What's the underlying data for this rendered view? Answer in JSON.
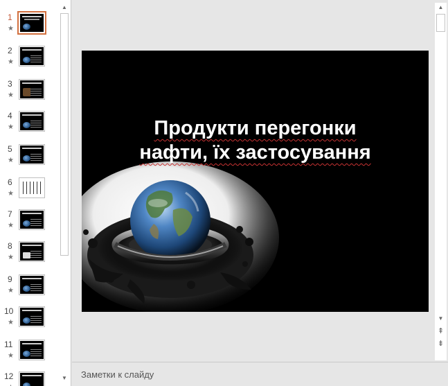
{
  "thumbnails": [
    {
      "number": "1",
      "star": "★",
      "selected": true
    },
    {
      "number": "2",
      "star": "★"
    },
    {
      "number": "3",
      "star": "★"
    },
    {
      "number": "4",
      "star": "★"
    },
    {
      "number": "5",
      "star": "★"
    },
    {
      "number": "6",
      "star": "★"
    },
    {
      "number": "7",
      "star": "★"
    },
    {
      "number": "8",
      "star": "★"
    },
    {
      "number": "9",
      "star": "★"
    },
    {
      "number": "10",
      "star": "★"
    },
    {
      "number": "11",
      "star": "★"
    },
    {
      "number": "12",
      "star": "★"
    }
  ],
  "slide": {
    "title_line1": "Продукти перегонки",
    "title_line2": "нафти, їх застосування"
  },
  "notes": {
    "placeholder": "Заметки к слайду"
  },
  "scroll": {
    "up_glyph": "▲",
    "down_glyph": "▼",
    "prev_slide_glyph": "⇞",
    "next_slide_glyph": "⇟"
  },
  "colors": {
    "accent_selection": "#d2703f",
    "slide_background": "#000000",
    "title_text": "#ffffff",
    "spellcheck_underline": "#c83232"
  }
}
